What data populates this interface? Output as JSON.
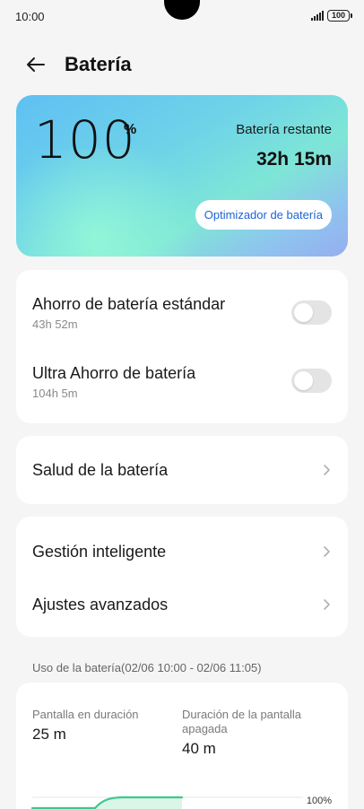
{
  "status": {
    "time": "10:00",
    "battery": "100"
  },
  "header": {
    "title": "Batería"
  },
  "hero": {
    "percent": "100",
    "percent_sign": "%",
    "remaining_label": "Batería restante",
    "remaining_value": "32h 15m",
    "optimizer_label": "Optimizador de batería"
  },
  "saving": {
    "items": [
      {
        "title": "Ahorro de batería estándar",
        "subtitle": "43h 52m",
        "enabled": false
      },
      {
        "title": "Ultra Ahorro de batería",
        "subtitle": "104h 5m",
        "enabled": false
      }
    ]
  },
  "health": {
    "title": "Salud de la batería"
  },
  "settings": {
    "items": [
      {
        "title": "Gestión inteligente"
      },
      {
        "title": "Ajustes avanzados"
      }
    ]
  },
  "usage": {
    "label": "Uso de la batería(02/06 10:00 - 02/06 11:05)",
    "screen_on_label": "Pantalla en duración",
    "screen_on_value": "25 m",
    "screen_off_label": "Duración de la pantalla apagada",
    "screen_off_value": "40 m",
    "chart_level_label": "100%"
  },
  "colors": {
    "accent": "#1e63d6",
    "chart_line": "#3cc98a",
    "chart_fill": "#d9f6e8"
  }
}
